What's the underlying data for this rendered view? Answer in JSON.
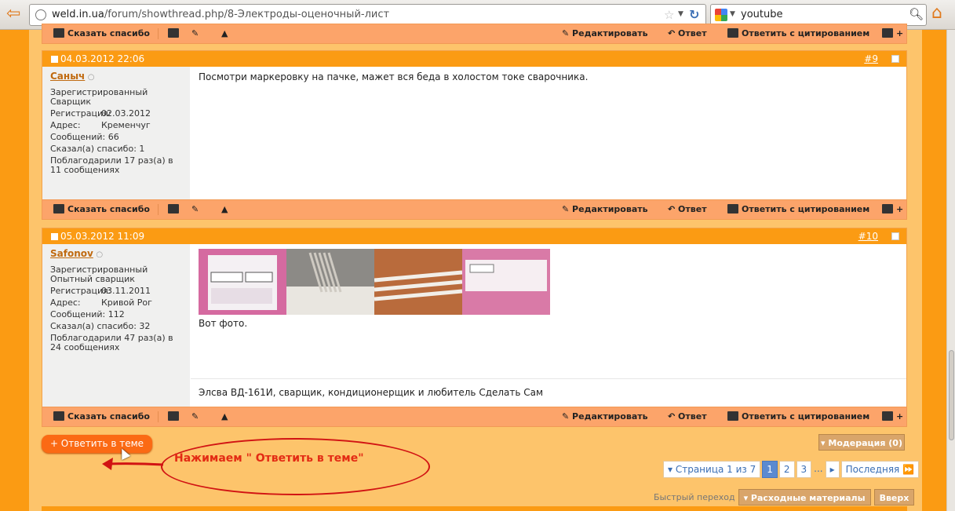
{
  "browser": {
    "url_domain": "weld.in.ua",
    "url_path": "/forum/showthread.php/8-Электроды-оценочный-лист",
    "search_query": "youtube"
  },
  "controls": {
    "thanks": "Сказать спасибо",
    "ip": "IP",
    "edit": "Редактировать",
    "reply": "Ответ",
    "quote": "Ответить с цитированием",
    "multiquote": "+"
  },
  "posts": [
    {
      "date": "04.03.2012 22:06",
      "number": "#9",
      "username": "Саныч",
      "online": "○",
      "title": "Зарегистрированный Сварщик",
      "reg_label": "Регистрация:",
      "reg": "02.03.2012",
      "addr_label": "Адрес:",
      "addr": "Кременчуг",
      "msgs_label": "Сообщений:",
      "msgs": "66",
      "thanks_label": "Сказал(а) спасибо:",
      "thanks": "1",
      "thanked": "Поблагодарили 17 раз(а) в 11 сообщениях",
      "message": "Посмотри маркеровку на пачке, мажет вся беда в холостом токе сварочника."
    },
    {
      "date": "05.03.2012 11:09",
      "number": "#10",
      "username": "Safonov",
      "online": "○",
      "title": "Зарегистрированный Опытный сварщик",
      "reg_label": "Регистрация:",
      "reg": "03.11.2011",
      "addr_label": "Адрес:",
      "addr": "Кривой Рог",
      "msgs_label": "Сообщений:",
      "msgs": "112",
      "thanks_label": "Сказал(а) спасибо:",
      "thanks": "32",
      "thanked": "Поблагодарили 47 раз(а) в 24 сообщениях",
      "message": "Вот фото.",
      "signature": "Элсва ВД-161И, сварщик, кондиционерщик и любитель Сделать Сам"
    }
  ],
  "thread_actions": {
    "reply_in_thread": "+ Ответить в теме",
    "annotation": "Нажимаем \" Ответить в теме\"",
    "moderation": "Модерация (0)"
  },
  "pagination": {
    "label": "Страница 1 из 7",
    "pages": [
      "1",
      "2",
      "3"
    ],
    "ellipsis": "...",
    "last": "Последняя"
  },
  "quicknav": {
    "label": "Быстрый переход",
    "forum": "Расходные материалы",
    "top": "Вверх"
  }
}
